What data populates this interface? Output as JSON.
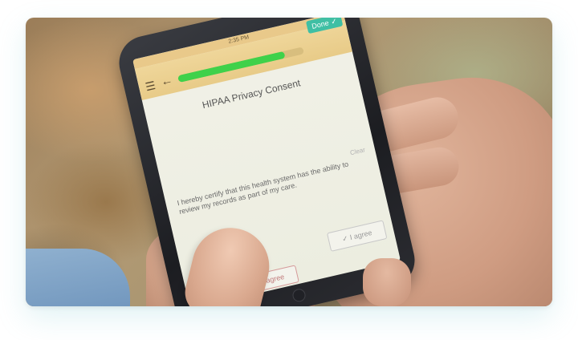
{
  "phone_screen": {
    "status_time": "2:35 PM",
    "progress_percent": 85,
    "done_label": "Done",
    "page_title": "HIPAA Privacy Consent",
    "clear_label": "Clear",
    "consent_text": "I hereby certify that this health system has the ability to review my records as part of my care.",
    "agree_label": "I agree",
    "disagree_label": "Don't agree"
  },
  "icons": {
    "menu": "menu-icon",
    "back": "back-arrow-icon",
    "check": "check-icon"
  },
  "colors": {
    "appbar": "#e8cb88",
    "progress_fill": "#3fd14a",
    "done_button": "#3fbfa4"
  }
}
